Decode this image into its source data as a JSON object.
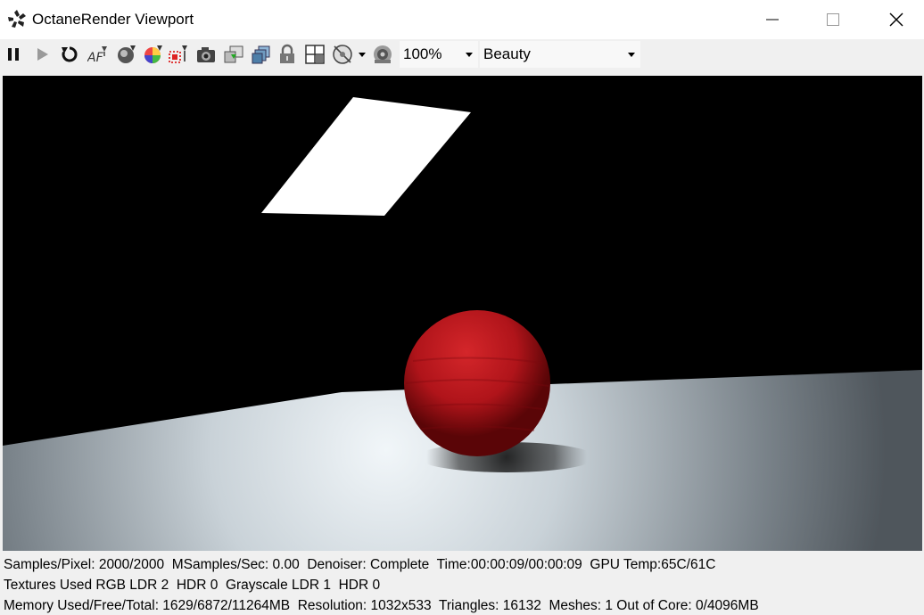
{
  "window": {
    "title": "OctaneRender Viewport",
    "app_icon": "octane-logo-icon"
  },
  "toolbar": {
    "icons": [
      "pause-icon",
      "play-icon",
      "restart-icon",
      "autofocus-icon",
      "material-picker-icon",
      "color-picker-icon",
      "region-render-icon",
      "camera-icon",
      "import-icon",
      "layers-icon",
      "lock-icon",
      "grid-icon",
      "options-icon",
      "settings-icon"
    ],
    "zoom_value": "100%",
    "pass_value": "Beauty"
  },
  "status": {
    "line1": "Samples/Pixel: 2000/2000  MSamples/Sec: 0.00  Denoiser: Complete  Time:00:00:09/00:00:09  GPU Temp:65C/61C",
    "line2": "Textures Used RGB LDR 2  HDR 0  Grayscale LDR 1  HDR 0",
    "line3": "Memory Used/Free/Total: 1629/6872/11264MB  Resolution: 1032x533  Triangles: 16132  Meshes: 1 Out of Core: 0/4096MB"
  },
  "colors": {
    "sphere": "#b81418",
    "floor_light": "#e8eef2",
    "floor_dark": "#5a6167",
    "background": "#000000"
  }
}
